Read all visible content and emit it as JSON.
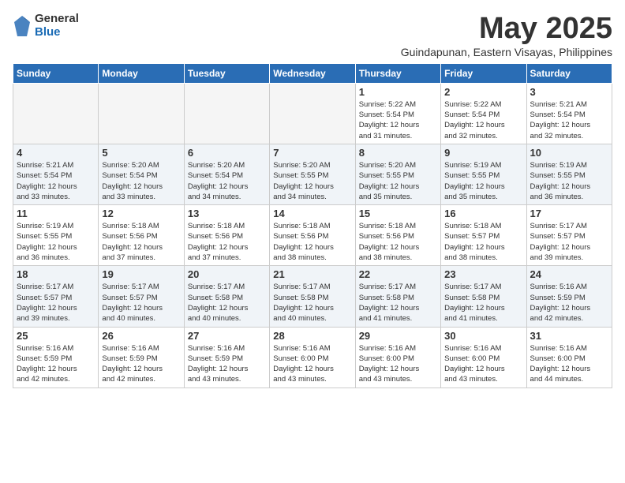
{
  "logo": {
    "general": "General",
    "blue": "Blue"
  },
  "title": "May 2025",
  "subtitle": "Guindapunan, Eastern Visayas, Philippines",
  "headers": [
    "Sunday",
    "Monday",
    "Tuesday",
    "Wednesday",
    "Thursday",
    "Friday",
    "Saturday"
  ],
  "weeks": [
    [
      {
        "day": "",
        "info": ""
      },
      {
        "day": "",
        "info": ""
      },
      {
        "day": "",
        "info": ""
      },
      {
        "day": "",
        "info": ""
      },
      {
        "day": "1",
        "info": "Sunrise: 5:22 AM\nSunset: 5:54 PM\nDaylight: 12 hours\nand 31 minutes."
      },
      {
        "day": "2",
        "info": "Sunrise: 5:22 AM\nSunset: 5:54 PM\nDaylight: 12 hours\nand 32 minutes."
      },
      {
        "day": "3",
        "info": "Sunrise: 5:21 AM\nSunset: 5:54 PM\nDaylight: 12 hours\nand 32 minutes."
      }
    ],
    [
      {
        "day": "4",
        "info": "Sunrise: 5:21 AM\nSunset: 5:54 PM\nDaylight: 12 hours\nand 33 minutes."
      },
      {
        "day": "5",
        "info": "Sunrise: 5:20 AM\nSunset: 5:54 PM\nDaylight: 12 hours\nand 33 minutes."
      },
      {
        "day": "6",
        "info": "Sunrise: 5:20 AM\nSunset: 5:54 PM\nDaylight: 12 hours\nand 34 minutes."
      },
      {
        "day": "7",
        "info": "Sunrise: 5:20 AM\nSunset: 5:55 PM\nDaylight: 12 hours\nand 34 minutes."
      },
      {
        "day": "8",
        "info": "Sunrise: 5:20 AM\nSunset: 5:55 PM\nDaylight: 12 hours\nand 35 minutes."
      },
      {
        "day": "9",
        "info": "Sunrise: 5:19 AM\nSunset: 5:55 PM\nDaylight: 12 hours\nand 35 minutes."
      },
      {
        "day": "10",
        "info": "Sunrise: 5:19 AM\nSunset: 5:55 PM\nDaylight: 12 hours\nand 36 minutes."
      }
    ],
    [
      {
        "day": "11",
        "info": "Sunrise: 5:19 AM\nSunset: 5:55 PM\nDaylight: 12 hours\nand 36 minutes."
      },
      {
        "day": "12",
        "info": "Sunrise: 5:18 AM\nSunset: 5:56 PM\nDaylight: 12 hours\nand 37 minutes."
      },
      {
        "day": "13",
        "info": "Sunrise: 5:18 AM\nSunset: 5:56 PM\nDaylight: 12 hours\nand 37 minutes."
      },
      {
        "day": "14",
        "info": "Sunrise: 5:18 AM\nSunset: 5:56 PM\nDaylight: 12 hours\nand 38 minutes."
      },
      {
        "day": "15",
        "info": "Sunrise: 5:18 AM\nSunset: 5:56 PM\nDaylight: 12 hours\nand 38 minutes."
      },
      {
        "day": "16",
        "info": "Sunrise: 5:18 AM\nSunset: 5:57 PM\nDaylight: 12 hours\nand 38 minutes."
      },
      {
        "day": "17",
        "info": "Sunrise: 5:17 AM\nSunset: 5:57 PM\nDaylight: 12 hours\nand 39 minutes."
      }
    ],
    [
      {
        "day": "18",
        "info": "Sunrise: 5:17 AM\nSunset: 5:57 PM\nDaylight: 12 hours\nand 39 minutes."
      },
      {
        "day": "19",
        "info": "Sunrise: 5:17 AM\nSunset: 5:57 PM\nDaylight: 12 hours\nand 40 minutes."
      },
      {
        "day": "20",
        "info": "Sunrise: 5:17 AM\nSunset: 5:58 PM\nDaylight: 12 hours\nand 40 minutes."
      },
      {
        "day": "21",
        "info": "Sunrise: 5:17 AM\nSunset: 5:58 PM\nDaylight: 12 hours\nand 40 minutes."
      },
      {
        "day": "22",
        "info": "Sunrise: 5:17 AM\nSunset: 5:58 PM\nDaylight: 12 hours\nand 41 minutes."
      },
      {
        "day": "23",
        "info": "Sunrise: 5:17 AM\nSunset: 5:58 PM\nDaylight: 12 hours\nand 41 minutes."
      },
      {
        "day": "24",
        "info": "Sunrise: 5:16 AM\nSunset: 5:59 PM\nDaylight: 12 hours\nand 42 minutes."
      }
    ],
    [
      {
        "day": "25",
        "info": "Sunrise: 5:16 AM\nSunset: 5:59 PM\nDaylight: 12 hours\nand 42 minutes."
      },
      {
        "day": "26",
        "info": "Sunrise: 5:16 AM\nSunset: 5:59 PM\nDaylight: 12 hours\nand 42 minutes."
      },
      {
        "day": "27",
        "info": "Sunrise: 5:16 AM\nSunset: 5:59 PM\nDaylight: 12 hours\nand 43 minutes."
      },
      {
        "day": "28",
        "info": "Sunrise: 5:16 AM\nSunset: 6:00 PM\nDaylight: 12 hours\nand 43 minutes."
      },
      {
        "day": "29",
        "info": "Sunrise: 5:16 AM\nSunset: 6:00 PM\nDaylight: 12 hours\nand 43 minutes."
      },
      {
        "day": "30",
        "info": "Sunrise: 5:16 AM\nSunset: 6:00 PM\nDaylight: 12 hours\nand 43 minutes."
      },
      {
        "day": "31",
        "info": "Sunrise: 5:16 AM\nSunset: 6:00 PM\nDaylight: 12 hours\nand 44 minutes."
      }
    ]
  ]
}
